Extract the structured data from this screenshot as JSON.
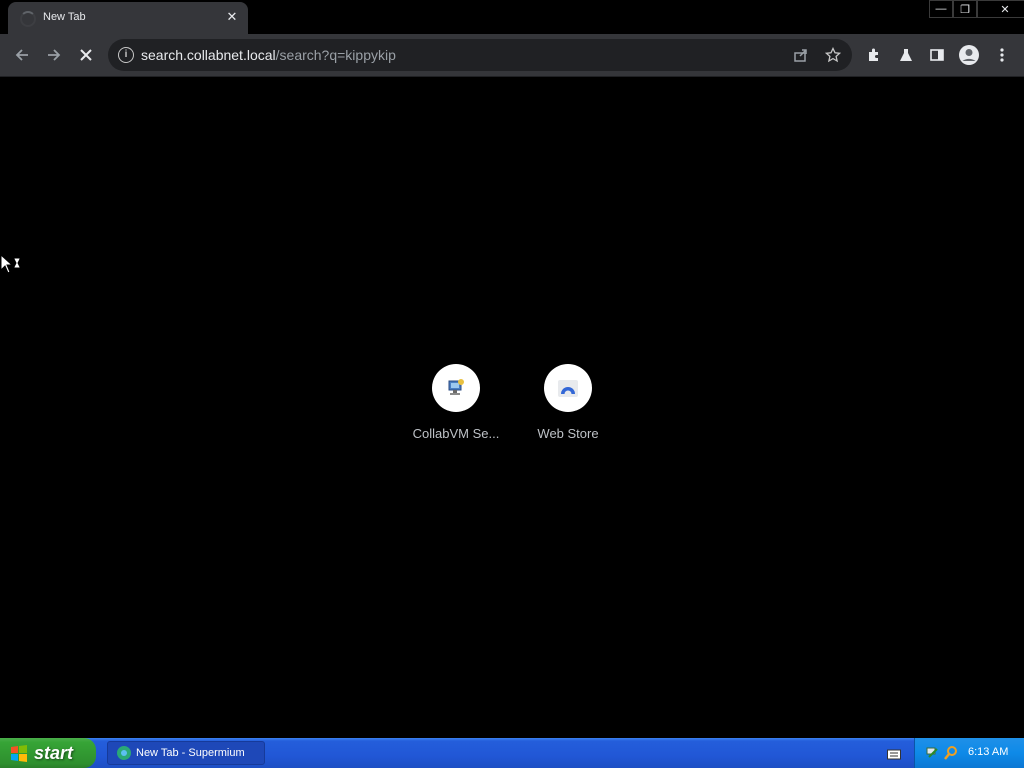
{
  "browser": {
    "tab": {
      "title": "New Tab",
      "close_glyph": "✕"
    },
    "window_controls": {
      "minimize": "—",
      "restore": "❐",
      "close": "✕"
    },
    "toolbar": {
      "url_host": "search.collabnet.local",
      "url_path": "/search?q=kippykip",
      "info_glyph": "i"
    },
    "shortcuts": [
      {
        "label": "CollabVM Se...",
        "icon": "collabvm-icon"
      },
      {
        "label": "Web Store",
        "icon": "web-store-icon"
      }
    ]
  },
  "taskbar": {
    "start_label": "start",
    "task_button_label": "New Tab - Supermium",
    "clock": "6:13 AM"
  },
  "colors": {
    "page_bg": "#000000",
    "toolbar_bg": "#35363a",
    "omnibox_bg": "#202124",
    "taskbar_blue": "#245edb",
    "start_green": "#36a436",
    "tray_blue": "#0e8ae8"
  }
}
